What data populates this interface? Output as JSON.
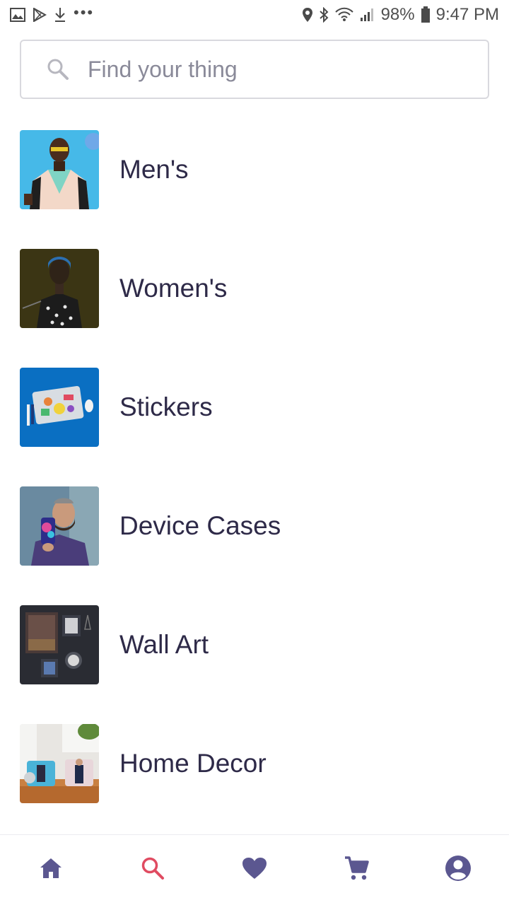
{
  "status_bar": {
    "battery": "98%",
    "time": "9:47 PM",
    "left_icons": [
      "gallery-icon",
      "play-store-icon",
      "download-icon",
      "more-dots-icon"
    ],
    "right_icons": [
      "location-icon",
      "bluetooth-icon",
      "wifi-icon",
      "signal-icon",
      "battery-icon"
    ]
  },
  "search": {
    "placeholder": "Find your thing",
    "value": ""
  },
  "categories": [
    {
      "label": "Men's",
      "thumb": "mens-thumbnail"
    },
    {
      "label": "Women's",
      "thumb": "womens-thumbnail"
    },
    {
      "label": "Stickers",
      "thumb": "stickers-thumbnail"
    },
    {
      "label": "Device Cases",
      "thumb": "device-cases-thumbnail"
    },
    {
      "label": "Wall Art",
      "thumb": "wall-art-thumbnail"
    },
    {
      "label": "Home Decor",
      "thumb": "home-decor-thumbnail"
    }
  ],
  "bottom_nav": {
    "items": [
      "home-icon",
      "search-icon",
      "heart-icon",
      "cart-icon",
      "account-icon"
    ],
    "active": "search-icon",
    "colors": {
      "default": "#5b5790",
      "active": "#e04b61"
    }
  },
  "colors": {
    "label_text": "#2e2a48",
    "search_border": "#d9d9de",
    "placeholder": "#8a8a99"
  }
}
